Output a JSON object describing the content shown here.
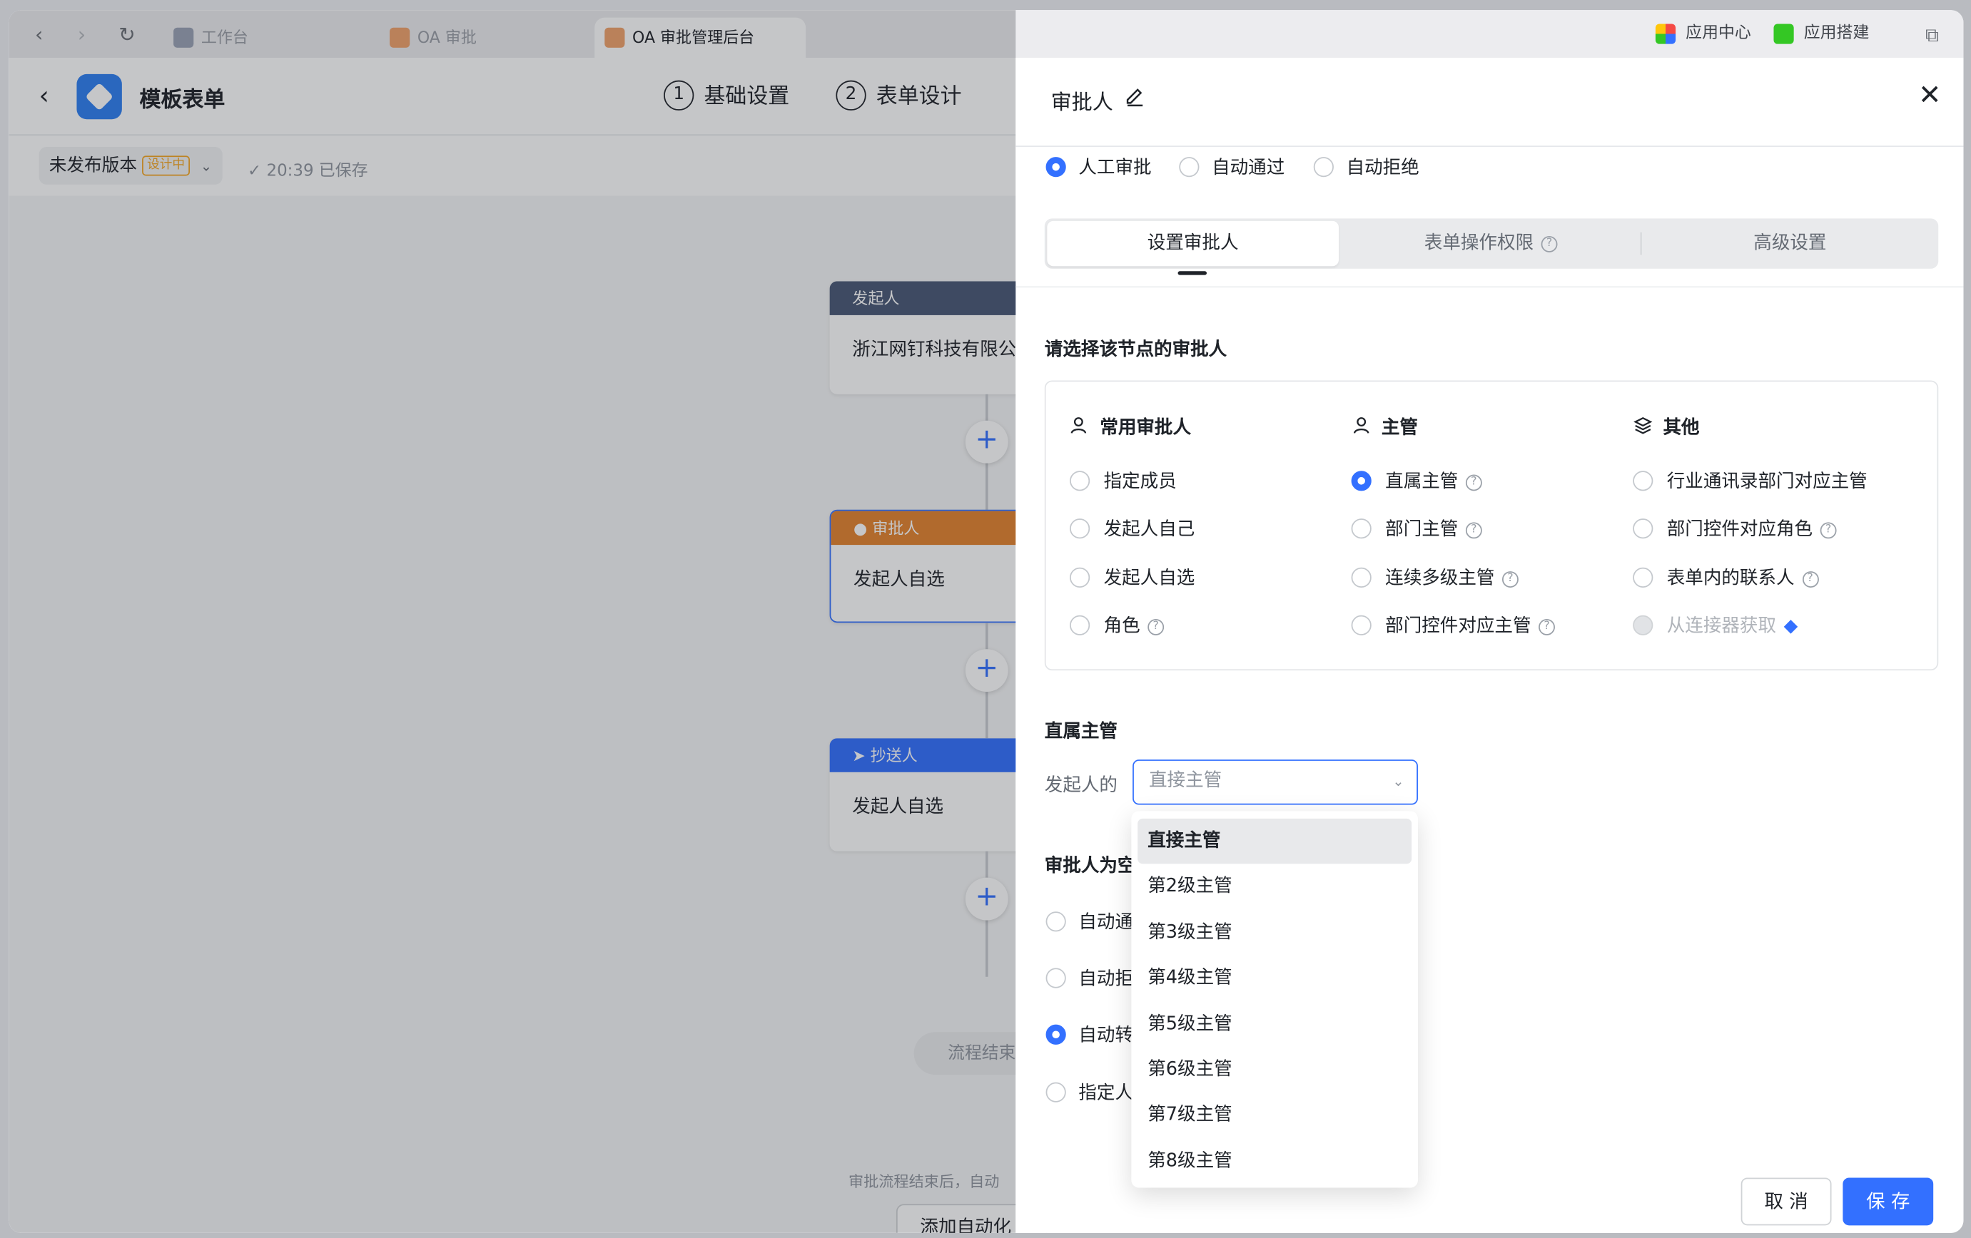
{
  "browser": {
    "tabs": [
      {
        "label": "工作台",
        "active": false
      },
      {
        "label": "OA 审批",
        "active": false
      },
      {
        "label": "OA 审批管理后台",
        "active": true
      }
    ],
    "right_items": [
      "应用中心",
      "应用搭建"
    ]
  },
  "app": {
    "title": "模板表单",
    "steps": [
      {
        "num": "1",
        "label": "基础设置"
      },
      {
        "num": "2",
        "label": "表单设计"
      }
    ],
    "version_label": "未发布版本",
    "version_badge": "设计中",
    "save_status": "20:39 已保存"
  },
  "flow": {
    "nodes": [
      {
        "header": "发起人",
        "body": "浙江网钉科技有限公",
        "color": "#4a5876"
      },
      {
        "header": "审批人",
        "body": "发起人自选",
        "color": "#e4832f"
      },
      {
        "header": "抄送人",
        "body": "发起人自选",
        "color": "#3370ff"
      }
    ],
    "end_label": "流程结束",
    "footer_text": "审批流程结束后，自动",
    "automation_button": "添加自动化"
  },
  "drawer": {
    "title": "审批人",
    "modes": [
      {
        "label": "人工审批",
        "checked": true
      },
      {
        "label": "自动通过",
        "checked": false
      },
      {
        "label": "自动拒绝",
        "checked": false
      }
    ],
    "tabs": [
      {
        "label": "设置审批人",
        "active": true
      },
      {
        "label": "表单操作权限",
        "active": false
      },
      {
        "label": "高级设置",
        "active": false
      }
    ],
    "section_title": "请选择该节点的审批人",
    "columns": [
      {
        "heading": "常用审批人",
        "icon": "user-icon",
        "options": [
          {
            "label": "指定成员",
            "checked": false,
            "help": false
          },
          {
            "label": "发起人自己",
            "checked": false,
            "help": false
          },
          {
            "label": "发起人自选",
            "checked": false,
            "help": false
          },
          {
            "label": "角色",
            "checked": false,
            "help": true
          }
        ]
      },
      {
        "heading": "主管",
        "icon": "manager-icon",
        "options": [
          {
            "label": "直属主管",
            "checked": true,
            "help": true
          },
          {
            "label": "部门主管",
            "checked": false,
            "help": true
          },
          {
            "label": "连续多级主管",
            "checked": false,
            "help": true
          },
          {
            "label": "部门控件对应主管",
            "checked": false,
            "help": true
          }
        ]
      },
      {
        "heading": "其他",
        "icon": "layers-icon",
        "options": [
          {
            "label": "行业通讯录部门对应主管",
            "checked": false,
            "help": false
          },
          {
            "label": "部门控件对应角色",
            "checked": false,
            "help": true
          },
          {
            "label": "表单内的联系人",
            "checked": false,
            "help": true
          },
          {
            "label": "从连接器获取",
            "checked": false,
            "help": false,
            "disabled": true
          }
        ]
      }
    ],
    "manager_section_title": "直属主管",
    "manager_prefix": "发起人的",
    "manager_select": {
      "placeholder": "直接主管",
      "options": [
        "直接主管",
        "第2级主管",
        "第3级主管",
        "第4级主管",
        "第5级主管",
        "第6级主管",
        "第7级主管",
        "第8级主管"
      ],
      "highlighted": "直接主管"
    },
    "empty_section_title": "审批人为空",
    "empty_options": [
      {
        "label": "自动通过",
        "checked": false
      },
      {
        "label": "自动拒绝",
        "checked": false
      },
      {
        "label": "自动转交",
        "checked": true
      },
      {
        "label": "指定人员",
        "checked": false
      }
    ],
    "cancel_label": "取 消",
    "save_label": "保 存"
  },
  "colors": {
    "accent": "#3370ff",
    "overlay": "rgba(31,35,41,0.26)"
  }
}
